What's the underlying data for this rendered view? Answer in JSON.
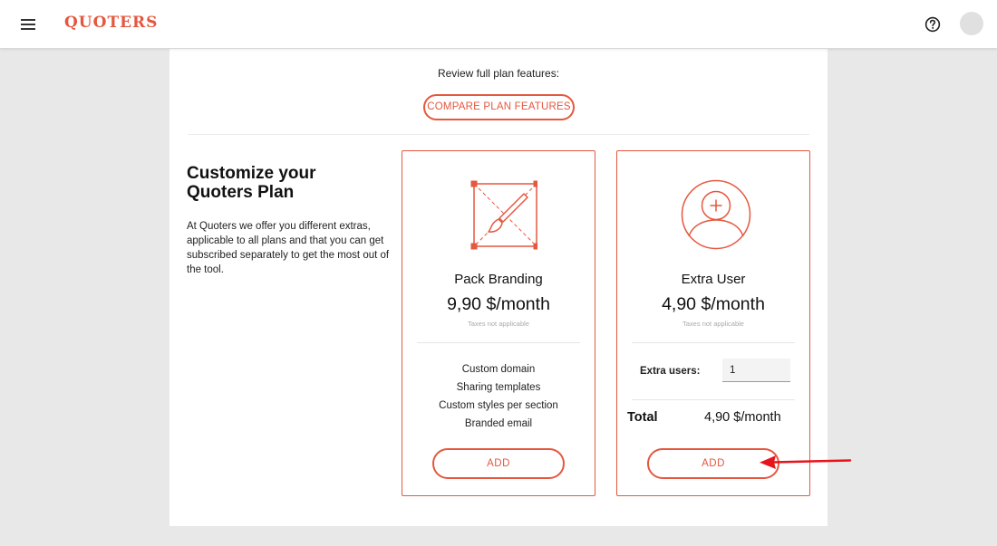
{
  "header": {
    "logo": "QUOTERS",
    "icons": {
      "menu": "hamburger-menu-icon",
      "help": "help-circle-icon",
      "avatar": "user-avatar"
    }
  },
  "review": {
    "text": "Review full plan features:",
    "compare_button": "COMPARE PLAN FEATURES"
  },
  "intro": {
    "title": "Customize your Quoters Plan",
    "text": "At Quoters we offer you different extras, applicable to all plans and that you can get subscribed separately to get the most out of the tool."
  },
  "plans": [
    {
      "name": "Pack Branding",
      "price": "9,90 $/month",
      "tax_note": "Taxes not applicable",
      "icon": "brush-frame-icon",
      "features": [
        "Custom domain",
        "Sharing templates",
        "Custom styles per section",
        "Branded email"
      ],
      "button": "ADD"
    },
    {
      "name": "Extra User",
      "price": "4,90 $/month",
      "tax_note": "Taxes not applicable",
      "icon": "add-user-icon",
      "extra_users_label": "Extra users:",
      "extra_users_value": "1",
      "total_label": "Total",
      "total_value": "4,90  $/month",
      "button": "ADD"
    }
  ],
  "colors": {
    "accent": "#e5573f",
    "annotation_arrow": "#e8141c"
  }
}
